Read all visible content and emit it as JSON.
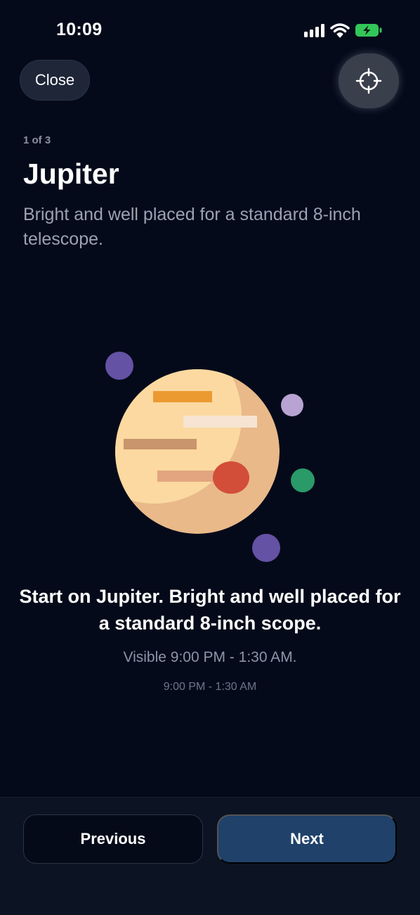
{
  "status_bar": {
    "time": "10:09",
    "icons": [
      "cellular-signal-icon",
      "wifi-icon",
      "battery-charging-icon"
    ]
  },
  "header": {
    "close_label": "Close",
    "locate_icon": "crosshair-icon"
  },
  "content": {
    "step": "1 of 3",
    "title": "Jupiter",
    "subtitle": "Bright and well placed for a standard 8-inch telescope.",
    "description": "Start on Jupiter. Bright and well placed for a standard 8-inch scope.",
    "visibility": "Visible 9:00 PM - 1:30 AM.",
    "time_range": "9:00 PM - 1:30 AM"
  },
  "footer": {
    "previous_label": "Previous",
    "next_label": "Next"
  },
  "colors": {
    "background": "#050a1a",
    "accent": "#1f416a",
    "planet_light": "#fbd9a0",
    "planet_shadow": "#e9b989",
    "great_red_spot": "#d24e38"
  }
}
